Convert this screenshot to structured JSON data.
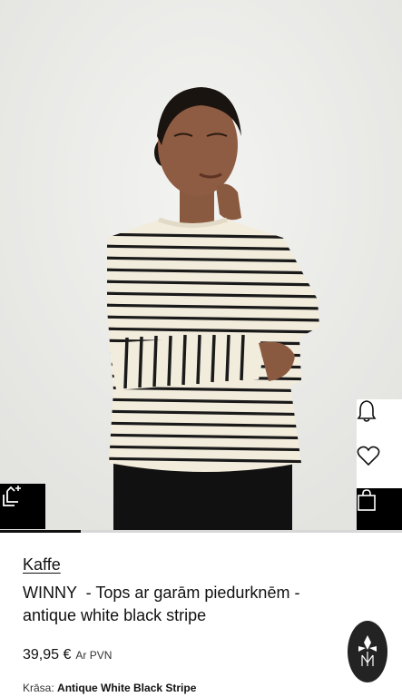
{
  "product": {
    "brand": "Kaffe",
    "title": "WINNY  - Tops ar garām piedurknēm - antique white black stripe",
    "price": "39,95 €",
    "vat_note": "Ar PVN",
    "color_label": "Krāsa:",
    "color_value": "Antique White Black Stripe"
  },
  "gallery": {
    "image_index": 1,
    "image_count": 5
  },
  "icons": {
    "size_fit": "size-fit-icon",
    "notify": "bell-icon",
    "wishlist": "heart-icon",
    "bag": "shopping-bag-icon",
    "assistant": "brand-assistant-icon"
  },
  "colors": {
    "shirt_base": "#f2ecdc",
    "stripe": "#1a1a1a",
    "background": "#ececea",
    "accent_dark": "#000000"
  }
}
